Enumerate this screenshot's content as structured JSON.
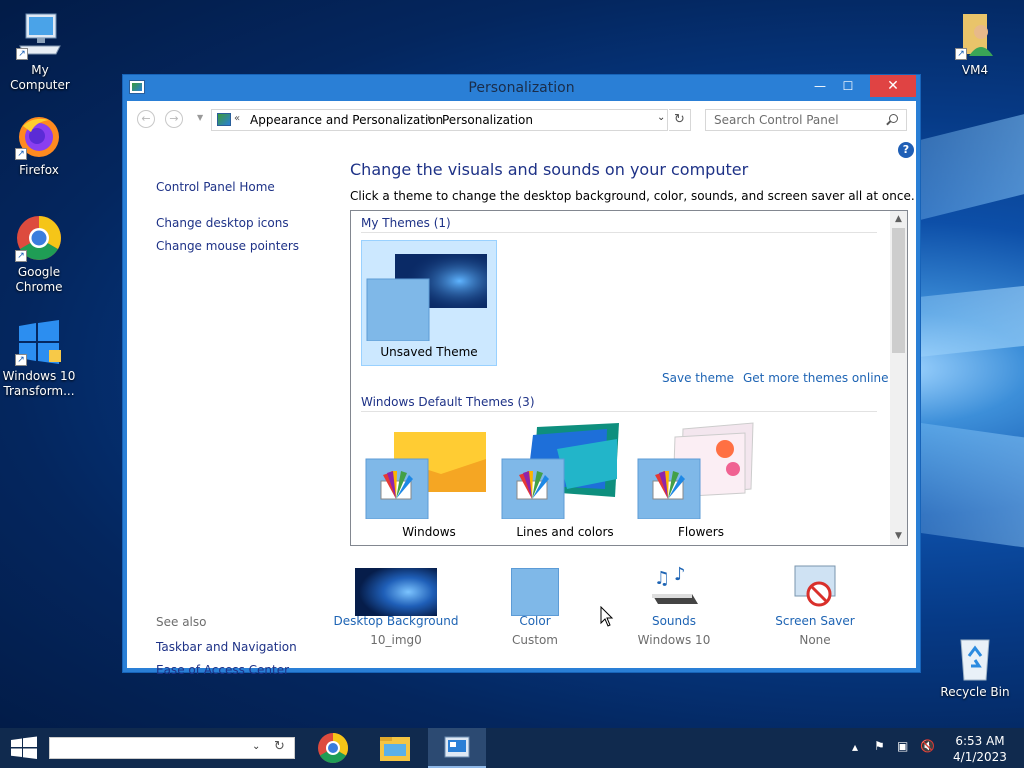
{
  "desktop": {
    "icons": [
      {
        "label": "My Computer"
      },
      {
        "label": "Firefox"
      },
      {
        "label": "Google Chrome"
      },
      {
        "label": "Windows 10 Transform..."
      },
      {
        "label": "VM4"
      },
      {
        "label": "Recycle Bin"
      }
    ]
  },
  "window": {
    "title": "Personalization",
    "controls": {
      "minimize": "—",
      "maximize": "☐",
      "close": "✕"
    }
  },
  "addressbar": {
    "overflow": "«",
    "breadcrumbs": [
      "Appearance and Personalization",
      "Personalization"
    ],
    "search_placeholder": "Search Control Panel"
  },
  "leftpane": {
    "home": "Control Panel Home",
    "links": [
      "Change desktop icons",
      "Change mouse pointers"
    ],
    "see_also_title": "See also",
    "see_also": [
      "Taskbar and Navigation",
      "Ease of Access Center"
    ]
  },
  "main": {
    "heading": "Change the visuals and sounds on your computer",
    "subheading": "Click a theme to change the desktop background, color, sounds, and screen saver all at once.",
    "my_themes_label": "My Themes (1)",
    "my_themes": [
      {
        "name": "Unsaved Theme",
        "selected": true
      }
    ],
    "save_theme": "Save theme",
    "more_themes": "Get more themes online",
    "default_themes_label": "Windows Default Themes (3)",
    "default_themes": [
      {
        "name": "Windows"
      },
      {
        "name": "Lines and colors"
      },
      {
        "name": "Flowers"
      }
    ],
    "help": "?"
  },
  "bottom": {
    "items": [
      {
        "label": "Desktop Background",
        "value": "10_img0"
      },
      {
        "label": "Color",
        "value": "Custom"
      },
      {
        "label": "Sounds",
        "value": "Windows 10"
      },
      {
        "label": "Screen Saver",
        "value": "None"
      }
    ]
  },
  "taskbar": {
    "time": "6:53 AM",
    "date": "4/1/2023"
  },
  "colors": {
    "link": "#1e3287",
    "accent": "#2a7fd6",
    "close": "#e04343",
    "selection": "#cce8ff"
  }
}
